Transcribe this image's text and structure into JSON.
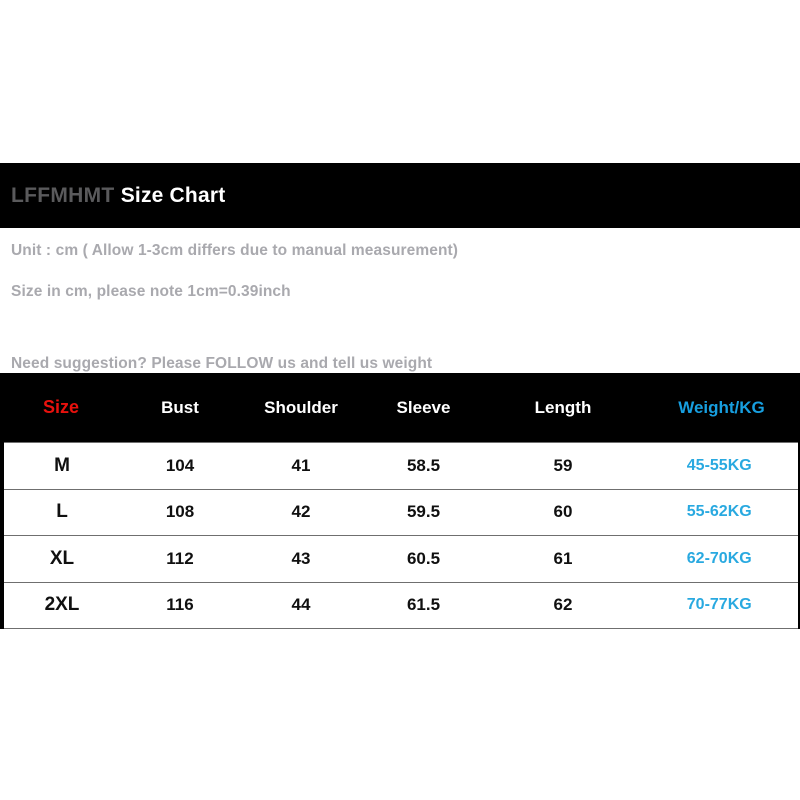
{
  "card": {
    "brand": "LFFMHMT ",
    "title": "Size Chart"
  },
  "info": {
    "unit_note": "Unit : cm ( Allow 1-3cm differs due to manual measurement)",
    "conversion_note": "Size in cm, please note 1cm=0.39inch",
    "suggestion_note": "Need suggestion? Please FOLLOW us and tell us weight"
  },
  "colors": {
    "background": "#000000",
    "panel": "#ffffff",
    "size_header": "#e8110d",
    "weight_header": "#179fe0",
    "weight_value": "#29a9e0",
    "info_text": "#a9a9ae",
    "brand_text": "#5a5a5c",
    "row_border": "#6f6f6f"
  },
  "table": {
    "headers": [
      "Size",
      "Bust",
      "Shoulder",
      "Sleeve",
      "Length",
      "Weight/KG"
    ],
    "rows": [
      {
        "size": "M",
        "bust": "104",
        "shoulder": "41",
        "sleeve": "58.5",
        "length": "59",
        "weight": "45-55KG"
      },
      {
        "size": "L",
        "bust": "108",
        "shoulder": "42",
        "sleeve": "59.5",
        "length": "60",
        "weight": "55-62KG"
      },
      {
        "size": "XL",
        "bust": "112",
        "shoulder": "43",
        "sleeve": "60.5",
        "length": "61",
        "weight": "62-70KG"
      },
      {
        "size": "2XL",
        "bust": "116",
        "shoulder": "44",
        "sleeve": "61.5",
        "length": "62",
        "weight": "70-77KG"
      }
    ]
  },
  "chart_data": {
    "type": "table",
    "title": "LFFMHMT Size Chart",
    "columns": [
      "Size",
      "Bust",
      "Shoulder",
      "Sleeve",
      "Length",
      "Weight/KG"
    ],
    "units": "cm",
    "rows": [
      [
        "M",
        104,
        41,
        58.5,
        59,
        "45-55KG"
      ],
      [
        "L",
        108,
        42,
        59.5,
        60,
        "55-62KG"
      ],
      [
        "XL",
        112,
        43,
        60.5,
        61,
        "62-70KG"
      ],
      [
        "2XL",
        116,
        44,
        61.5,
        62,
        "70-77KG"
      ]
    ],
    "notes": [
      "Unit : cm ( Allow 1-3cm differs due to manual measurement)",
      "Size in cm, please note 1cm=0.39inch",
      "Need suggestion? Please FOLLOW us and tell us weight"
    ]
  }
}
